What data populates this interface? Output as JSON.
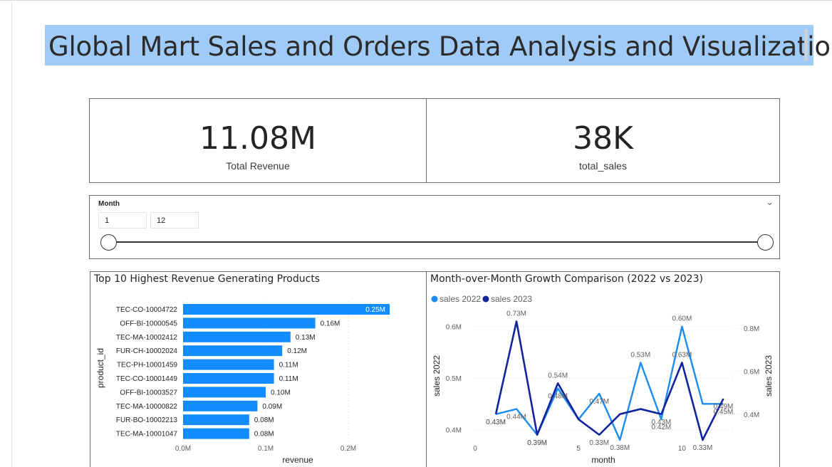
{
  "header": {
    "title": "Global Mart Sales and Orders Data Analysis and Visualization"
  },
  "kpi": {
    "revenue": {
      "value": "11.08M",
      "label": "Total Revenue"
    },
    "sales": {
      "value": "38K",
      "label": "total_sales"
    }
  },
  "slicer": {
    "title": "Month",
    "start": "1",
    "end": "12",
    "min": 1,
    "max": 12,
    "chevron": "chevron-down-icon"
  },
  "colors": {
    "bar": "#118dff",
    "sales_2022": "#1a8cf0",
    "sales_2023": "#12239e",
    "title_bg": "#a0cbf7"
  },
  "chart_data": [
    {
      "type": "bar",
      "orientation": "horizontal",
      "title": "Top 10 Highest Revenue Generating Products",
      "xlabel": "revenue",
      "ylabel": "product_id",
      "xlim": [
        0,
        0.25
      ],
      "x_ticks": [
        "0.0M",
        "0.1M",
        "0.2M"
      ],
      "x_tick_values": [
        0,
        0.1,
        0.2
      ],
      "categories": [
        "TEC-CO-10004722",
        "OFF-BI-10000545",
        "TEC-MA-10002412",
        "FUR-CH-10002024",
        "TEC-PH-10001459",
        "TEC-CO-10001449",
        "OFF-BI-10003527",
        "TEC-MA-10000822",
        "FUR-BO-10002213",
        "TEC-MA-10001047"
      ],
      "values": [
        0.25,
        0.16,
        0.13,
        0.12,
        0.11,
        0.11,
        0.1,
        0.09,
        0.08,
        0.08
      ],
      "labels": [
        "0.25M",
        "0.16M",
        "0.13M",
        "0.12M",
        "0.11M",
        "0.11M",
        "0.10M",
        "0.09M",
        "0.08M",
        "0.08M"
      ]
    },
    {
      "type": "line",
      "title": "Month-over-Month Growth Comparison (2022 vs 2023)",
      "xlabel": "month",
      "ylabel_left": "sales 2022",
      "ylabel_right": "sales 2023",
      "x": [
        1,
        2,
        3,
        4,
        5,
        6,
        7,
        8,
        9,
        10,
        11,
        12
      ],
      "xlim": [
        0,
        12.5
      ],
      "x_ticks": [
        "0",
        "5",
        "10"
      ],
      "x_tick_values": [
        0,
        5,
        10
      ],
      "y_left_lim": [
        0.38,
        0.63
      ],
      "y_left_ticks": [
        "0.4M",
        "0.5M",
        "0.6M"
      ],
      "y_left_tick_values": [
        0.4,
        0.5,
        0.6
      ],
      "y_right_lim": [
        0.28,
        0.88
      ],
      "y_right_ticks": [
        "0.4M",
        "0.6M",
        "0.8M"
      ],
      "y_right_tick_values": [
        0.4,
        0.6,
        0.8
      ],
      "legend": "top-left",
      "series": [
        {
          "name": "sales 2022",
          "axis": "left",
          "values": [
            0.43,
            0.44,
            0.39,
            0.48,
            0.42,
            0.47,
            0.38,
            0.53,
            0.42,
            0.6,
            0.45,
            0.45
          ],
          "labels": [
            "0.43M",
            "0.44M",
            "0.39M",
            "0.48M",
            "",
            "0.47M",
            "0.38M",
            "0.53M",
            "0.42M",
            "0.60M",
            "",
            "0.45M"
          ]
        },
        {
          "name": "sales 2023",
          "axis": "left",
          "values": [
            0.43,
            0.61,
            0.39,
            0.49,
            0.42,
            0.39,
            0.43,
            0.44,
            0.43,
            0.53,
            0.38,
            0.46
          ],
          "labels": [
            "0.43M",
            "0.73M",
            "0.39M",
            "0.54M",
            "",
            "0.33M",
            "",
            "",
            "0.43M",
            "0.63M",
            "0.33M",
            "0.49M"
          ]
        }
      ]
    }
  ]
}
